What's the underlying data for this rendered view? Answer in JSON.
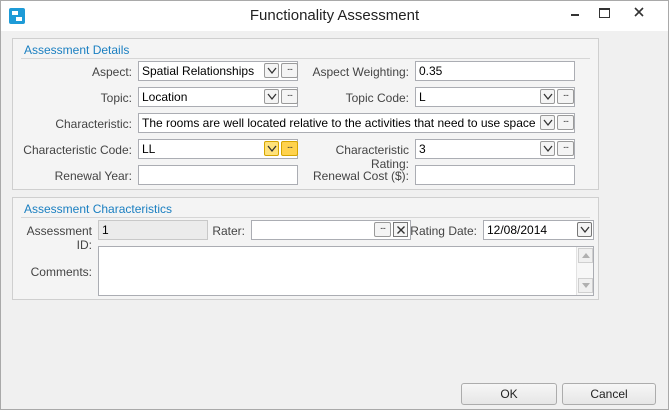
{
  "window": {
    "title": "Functionality Assessment"
  },
  "details": {
    "title": "Assessment Details",
    "aspect_label": "Aspect:",
    "aspect_value": "Spatial Relationships",
    "aspect_weighting_label": "Aspect Weighting:",
    "aspect_weighting_value": "0.35",
    "topic_label": "Topic:",
    "topic_value": "Location",
    "topic_code_label": "Topic Code:",
    "topic_code_value": "L",
    "characteristic_label": "Characteristic:",
    "characteristic_value": "The rooms are well located relative to the activities that need to use space",
    "char_code_label": "Characteristic Code:",
    "char_code_value": "LL",
    "char_rating_label": "Characteristic Rating:",
    "char_rating_value": "3",
    "renewal_year_label": "Renewal Year:",
    "renewal_year_value": "",
    "renewal_cost_label": "Renewal Cost ($):",
    "renewal_cost_value": ""
  },
  "characteristics": {
    "title": "Assessment Characteristics",
    "assessment_id_label": "Assessment ID:",
    "assessment_id_value": "1",
    "rater_label": "Rater:",
    "rater_value": "",
    "rating_date_label": "Rating Date:",
    "rating_date_value": "12/08/2014",
    "comments_label": "Comments:",
    "comments_value": ""
  },
  "buttons": {
    "ok": "OK",
    "cancel": "Cancel",
    "ellipsis": "..."
  },
  "icons": {
    "app": "app-icon",
    "minimize": "minimize-icon",
    "maximize": "maximize-icon",
    "close": "close-icon",
    "dropdown": "chevron-down-icon",
    "clear": "clear-x-icon",
    "scroll_up": "scroll-up-icon",
    "scroll_down": "scroll-down-icon"
  },
  "colors": {
    "accent": "#1a7fc1",
    "highlight": "#ffd24d"
  }
}
